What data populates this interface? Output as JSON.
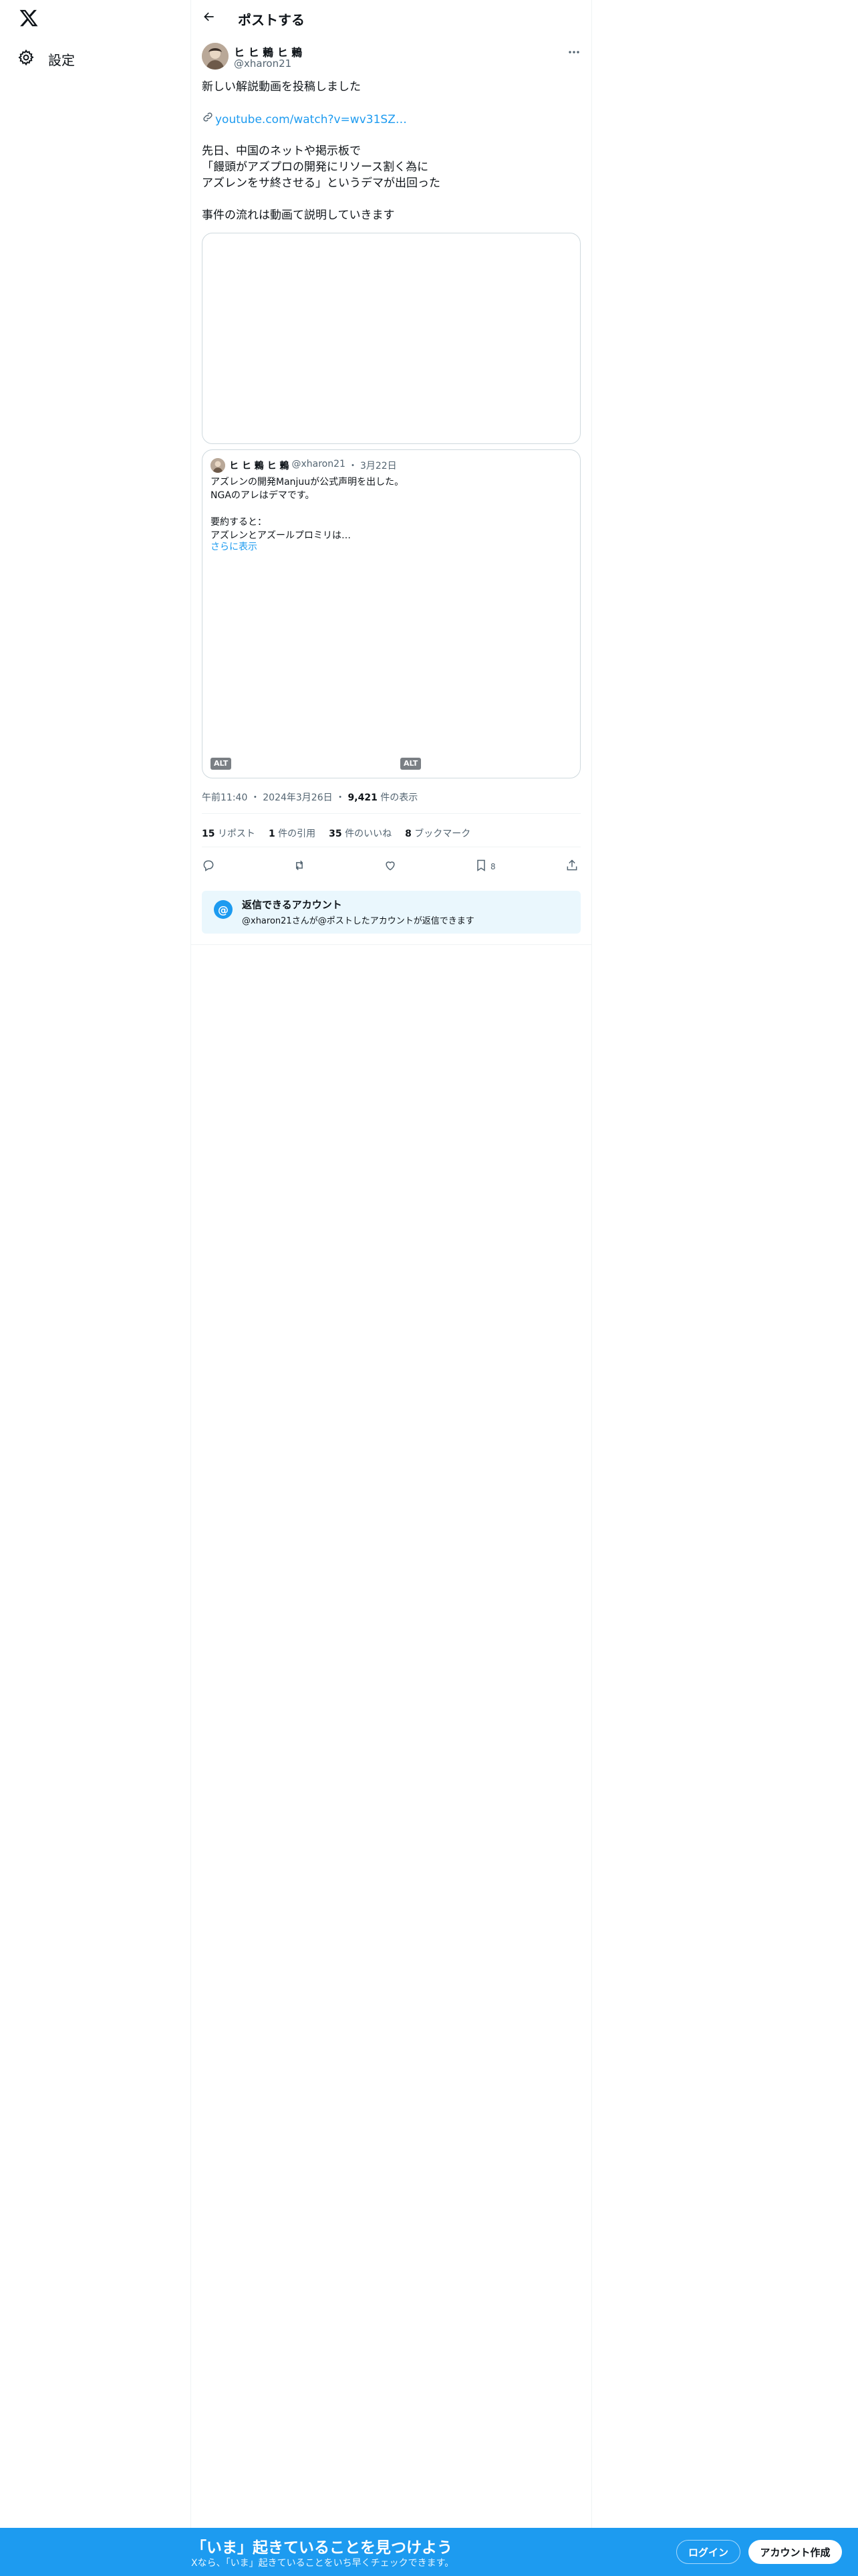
{
  "nav": {
    "settings_label": "設定"
  },
  "header": {
    "title": "ポストする"
  },
  "post": {
    "author_name": "ヒ ヒ 鶫 ヒ 鶫",
    "author_handle": "@xharon21",
    "line1": "新しい解説動画を投稿しました",
    "link_text": "youtube.com/watch?v=wv31SZ…",
    "para2": "先日、中国のネットや掲示板で\n「饅頭がアズプロの開発にリソース割く為に\nアズレンをサ終させる」というデマが出回った",
    "para3": "事件の流れは動画て説明していきます"
  },
  "quote": {
    "author_name": "ヒ ヒ 鶫 ヒ 鶫",
    "handle": "@xharon21",
    "sep": "・",
    "date": "3月22日",
    "text": "アズレンの開発Manjuuが公式声明を出した。\nNGAのアレはデマです。\n\n要約すると：\nアズレンとアズールプロミリは…",
    "show_more": "さらに表示",
    "alt_label": "ALT"
  },
  "meta": {
    "time": "午前11:40",
    "sep": "・",
    "date": "2024年3月26日",
    "views_count": "9,421",
    "views_label": "件の表示"
  },
  "stats": {
    "reposts_count": "15",
    "reposts_label": "リポスト",
    "quotes_count": "1",
    "quotes_label": "件の引用",
    "likes_count": "35",
    "likes_label": "件のいいね",
    "bookmarks_count": "8",
    "bookmarks_label": "ブックマーク"
  },
  "actions": {
    "bookmark_count": "8"
  },
  "reply_restriction": {
    "icon_glyph": "@",
    "title": "返信できるアカウント",
    "subtitle": "@xharon21さんが@ポストしたアカウントが返信できます"
  },
  "banner": {
    "title": "「いま」起きていることを見つけよう",
    "subtitle": "Xなら、「いま」起きていることをいち早くチェックできます。",
    "login_label": "ログイン",
    "signup_label": "アカウント作成"
  },
  "colors": {
    "accent": "#1d9bf0",
    "text": "#0f1419",
    "muted": "#536471",
    "border": "#cfd9de",
    "reply_bg": "#eaf7fd"
  }
}
